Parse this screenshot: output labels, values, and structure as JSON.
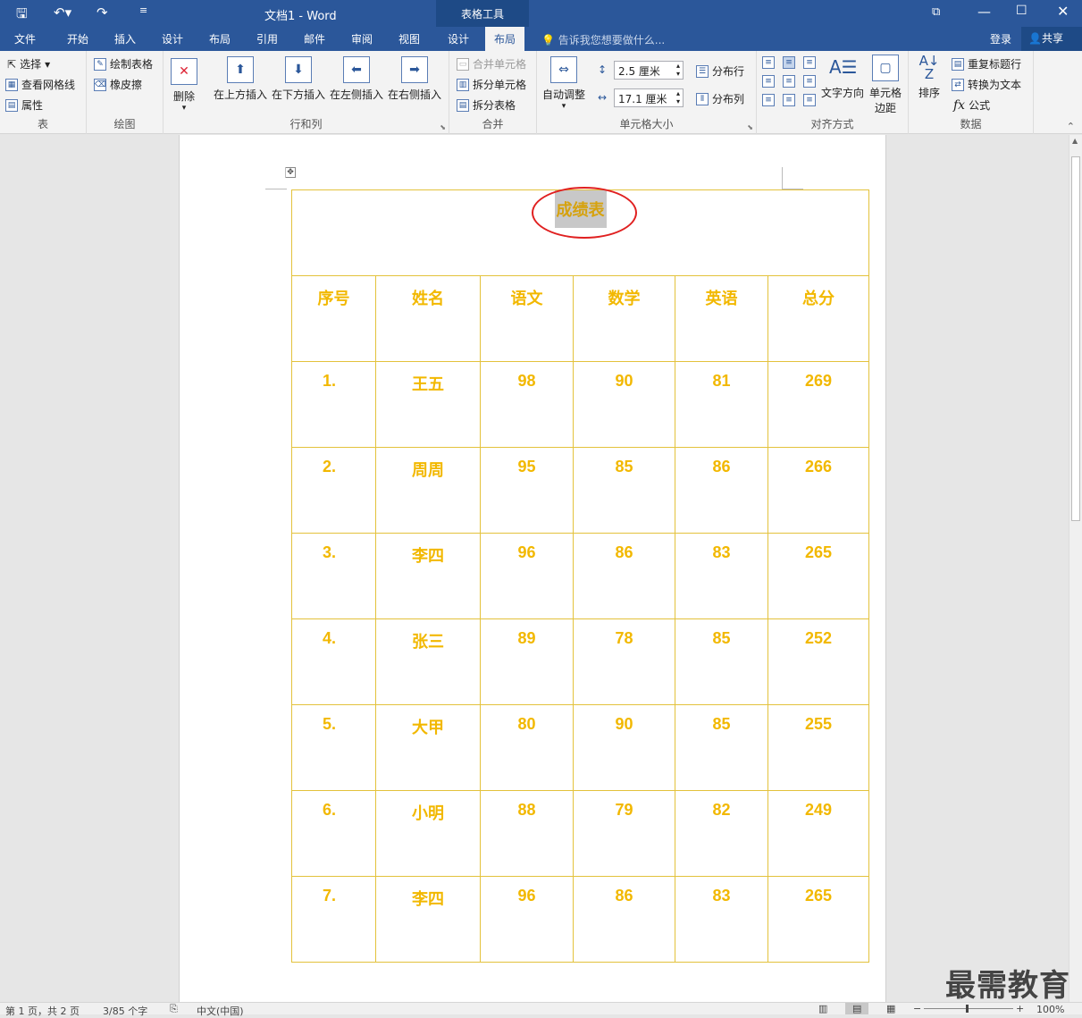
{
  "window": {
    "title": "文档1 - Word",
    "context_tab": "表格工具"
  },
  "qat": {
    "save": "save-icon",
    "undo": "undo-icon",
    "redo": "redo-icon"
  },
  "tabs": [
    "文件",
    "开始",
    "插入",
    "设计",
    "布局",
    "引用",
    "邮件",
    "审阅",
    "视图",
    "设计",
    "布局"
  ],
  "tell_me": "告诉我您想要做什么...",
  "account": {
    "login": "登录",
    "share": "共享"
  },
  "ribbon": {
    "table": {
      "label": "表",
      "select": "选择",
      "gridlines": "查看网格线",
      "properties": "属性"
    },
    "draw": {
      "label": "绘图",
      "draw_table": "绘制表格",
      "eraser": "橡皮擦"
    },
    "rows_cols": {
      "label": "行和列",
      "delete": "删除",
      "insert_above": "在上方插入",
      "insert_below": "在下方插入",
      "insert_left": "在左侧插入",
      "insert_right": "在右侧插入"
    },
    "merge": {
      "label": "合并",
      "merge_cells": "合并单元格",
      "split_cells": "拆分单元格",
      "split_table": "拆分表格"
    },
    "cell_size": {
      "label": "单元格大小",
      "autofit": "自动调整",
      "height": "2.5 厘米",
      "width": "17.1 厘米",
      "distribute_rows": "分布行",
      "distribute_cols": "分布列"
    },
    "alignment": {
      "label": "对齐方式",
      "text_direction": "文字方向",
      "cell_margins_1": "单元格",
      "cell_margins_2": "边距"
    },
    "data": {
      "label": "数据",
      "sort": "排序",
      "repeat_header": "重复标题行",
      "convert_text": "转换为文本",
      "formula": "公式"
    }
  },
  "table": {
    "title": "成绩表",
    "headers": [
      "序号",
      "姓名",
      "语文",
      "数学",
      "英语",
      "总分"
    ],
    "rows": [
      [
        "1.",
        "王五",
        "98",
        "90",
        "81",
        "269"
      ],
      [
        "2.",
        "周周",
        "95",
        "85",
        "86",
        "266"
      ],
      [
        "3.",
        "李四",
        "96",
        "86",
        "83",
        "265"
      ],
      [
        "4.",
        "张三",
        "89",
        "78",
        "85",
        "252"
      ],
      [
        "5.",
        "大甲",
        "80",
        "90",
        "85",
        "255"
      ],
      [
        "6.",
        "小明",
        "88",
        "79",
        "82",
        "249"
      ],
      [
        "7.",
        "李四",
        "96",
        "86",
        "83",
        "265"
      ]
    ]
  },
  "status": {
    "page": "第 1 页，共 2 页",
    "words": "3/85 个字",
    "lang": "中文(中国)",
    "zoom": "100%"
  },
  "watermark": "最需教育",
  "colors": {
    "brand": "#2b579a",
    "table_text": "#f2b800",
    "table_border": "#e3c23c",
    "annotation": "#e02020"
  }
}
